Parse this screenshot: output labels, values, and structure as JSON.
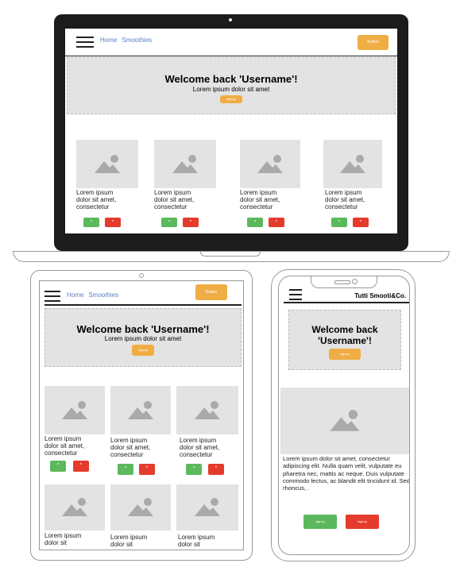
{
  "desktop": {
    "nav": [
      "Home",
      "Smoothies"
    ],
    "button_label": "Button",
    "hero_title": "Welcome back 'Username'!",
    "hero_subtitle": "Lorem ipsum dolor sit amet",
    "signup_label": "signup",
    "card_text": [
      "Lorem ipsum",
      "dolor sit amet,",
      "consectetur"
    ],
    "card_btn_green": "a",
    "card_btn_red": "b"
  },
  "tablet": {
    "nav": [
      "Home",
      "Smoothies"
    ],
    "button_label": "Button",
    "hero_title": "Welcome back 'Username'!",
    "hero_subtitle": "Lorem ipsum dolor sit amet",
    "signup_label": "signup",
    "card_text": [
      "Lorem ipsum",
      "dolor sit amet,",
      "consectetur"
    ],
    "card_text_short": [
      "Lorem ipsum",
      "dolor sit"
    ],
    "card_btn_green": "a",
    "card_btn_red": "b"
  },
  "phone": {
    "brand": "Tutti Smooti&Co.",
    "hero_title_1": "Welcome back",
    "hero_title_2": "'Username'!",
    "signup_label": "signup",
    "body_text": "Lorem ipsum dolor sit amet, consectetur adipiscing elit. Nulla quam velit, vulputate eu pharetra nec, mattis ac neque. Duis vulputate commodo lectus, ac blandit elit tincidunt id. Sed rhoncus, .",
    "btn_green": "signup",
    "btn_red": "signup"
  }
}
